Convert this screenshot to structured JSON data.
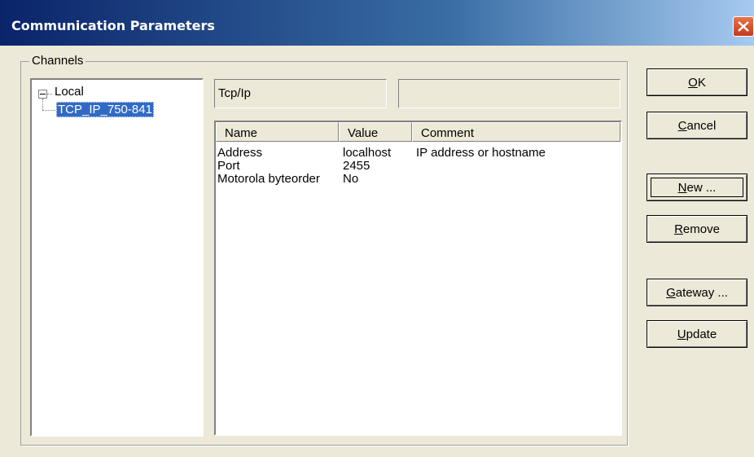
{
  "window": {
    "title": "Communication Parameters",
    "close_label": "close"
  },
  "channels": {
    "group_label": "Channels",
    "tree": {
      "root": "Local",
      "children": [
        "TCP_IP_750-841"
      ]
    }
  },
  "channel_details": {
    "name_field": "Tcp/Ip",
    "extra_field": ""
  },
  "params_table": {
    "columns": [
      "Name",
      "Value",
      "Comment"
    ],
    "rows": [
      {
        "name": "Address",
        "value": "localhost",
        "comment": "IP address or hostname"
      },
      {
        "name": "Port",
        "value": "2455",
        "comment": ""
      },
      {
        "name": "Motorola byteorder",
        "value": "No",
        "comment": ""
      }
    ]
  },
  "buttons": {
    "ok": {
      "mnemonic": "O",
      "rest": "K"
    },
    "cancel": {
      "mnemonic": "C",
      "rest": "ancel"
    },
    "new": {
      "mnemonic": "N",
      "rest": "ew ..."
    },
    "remove": {
      "mnemonic": "R",
      "rest": "emove"
    },
    "gateway": {
      "mnemonic": "G",
      "rest": "ateway ..."
    },
    "update": {
      "mnemonic": "U",
      "rest": "pdate"
    }
  }
}
